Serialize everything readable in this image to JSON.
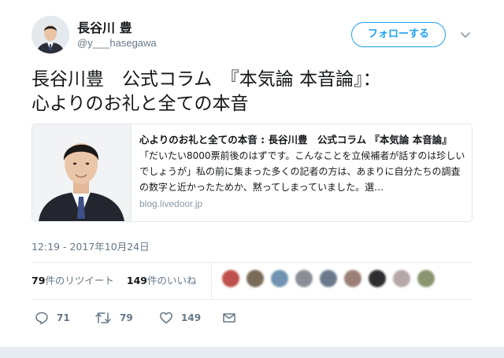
{
  "user": {
    "name": "長谷川 豊",
    "handle": "@y___hasegawa"
  },
  "follow_button": {
    "label": "フォローする"
  },
  "tweet": {
    "text": "長谷川豊　公式コラム　『本気論 本音論』：\n心よりのお礼と全ての本音",
    "timestamp": "12:19 - 2017年10月24日"
  },
  "card": {
    "title": "心よりのお礼と全ての本音 : 長谷川豊　公式コラム 『本気論 本音論』",
    "description": "「だいたい8000票前後のはずです。こんなことを立候補者が話すのは珍しいでしょうが」私の前に集まった多くの記者の方は、あまりに自分たちの調査の数字と近かったためか、黙ってしまっていました。選…",
    "domain": "blog.livedoor.jp"
  },
  "stats": {
    "retweets_count": "79",
    "retweets_label": "件のリツイート",
    "likes_count": "149",
    "likes_label": "件のいいね"
  },
  "likers": [
    {
      "color": "#c0504d"
    },
    {
      "color": "#7a6a58"
    },
    {
      "color": "#6f93b0"
    },
    {
      "color": "#8a8f96"
    },
    {
      "color": "#6a7a8c"
    },
    {
      "color": "#9b7f76"
    },
    {
      "color": "#2e2e30"
    },
    {
      "color": "#b5a8a6"
    },
    {
      "color": "#8a9670"
    }
  ],
  "actions": {
    "reply_count": "71",
    "retweet_count": "79",
    "like_count": "149"
  },
  "colors": {
    "accent": "#1da1f2",
    "text": "#14171a",
    "secondary": "#657786",
    "border": "#e1e8ed"
  },
  "icons": {
    "reply": "reply-icon",
    "retweet": "retweet-icon",
    "like": "heart-icon",
    "dm": "mail-icon",
    "more": "chevron-down-icon"
  }
}
